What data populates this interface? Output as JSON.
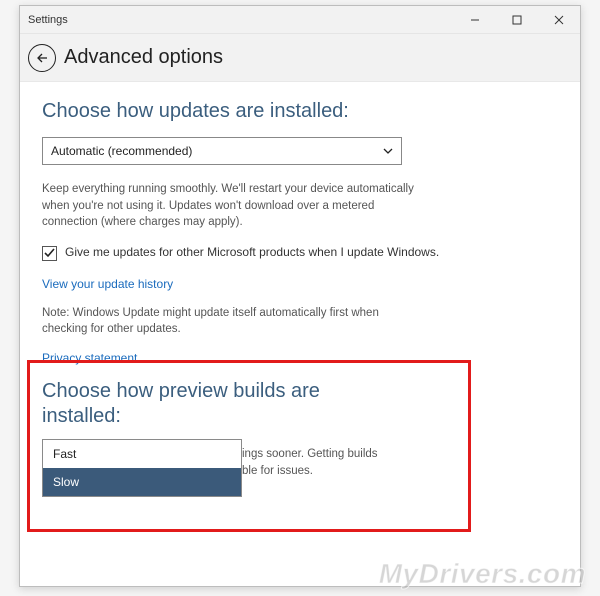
{
  "title": "Settings",
  "header": {
    "title": "Advanced options"
  },
  "updates": {
    "heading": "Choose how updates are installed:",
    "dropdown_value": "Automatic (recommended)",
    "description": "Keep everything running smoothly. We'll restart your device automatically when you're not using it. Updates won't download over a metered connection (where charges may apply).",
    "checkbox_checked": true,
    "checkbox_label": "Give me updates for other Microsoft products when I update Windows.",
    "history_link": "View your update history",
    "note": "Note: Windows Update might update itself automatically first when checking for other updates.",
    "privacy_link": "Privacy statement"
  },
  "preview": {
    "heading": "Choose how preview builds are installed:",
    "partial_line1": "ings sooner. Getting builds",
    "partial_line2": "ble for issues.",
    "options": {
      "fast": "Fast",
      "slow": "Slow"
    }
  },
  "watermark": "MyDrivers.com"
}
